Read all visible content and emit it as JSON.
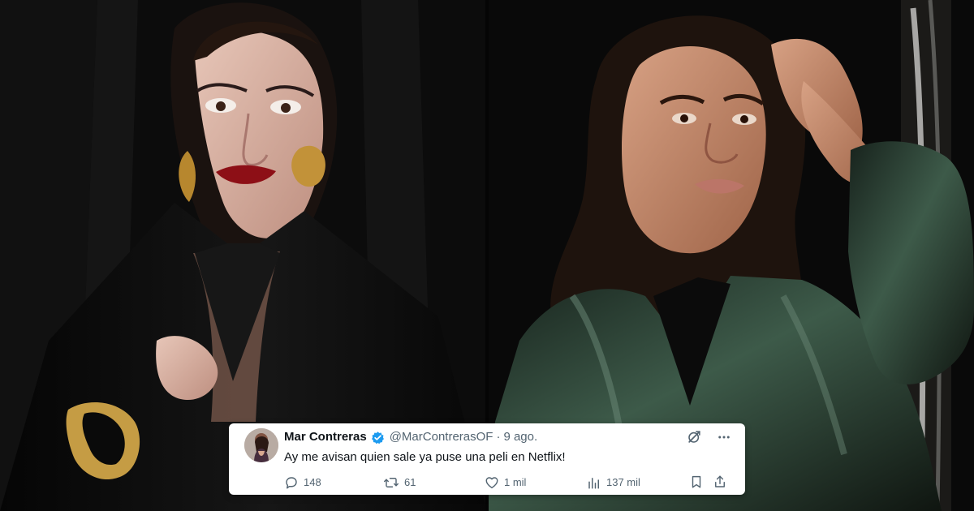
{
  "tweet": {
    "author_name": "Mar Contreras",
    "handle": "@MarContrerasOF",
    "separator": "·",
    "timestamp": "9 ago.",
    "text": "Ay me avisan quien sale ya puse una peli en Netflix!",
    "stats": {
      "replies": "148",
      "retweets": "61",
      "likes": "1 mil",
      "views": "137 mil"
    }
  },
  "colors": {
    "accent": "#1d9bf0",
    "muted_text": "#536471",
    "primary_text": "#0f1419",
    "card_background": "#ffffff"
  },
  "icons": [
    "verified-badge-icon",
    "grok-icon",
    "more-icon",
    "reply-icon",
    "retweet-icon",
    "like-icon",
    "views-icon",
    "bookmark-icon",
    "share-icon"
  ]
}
